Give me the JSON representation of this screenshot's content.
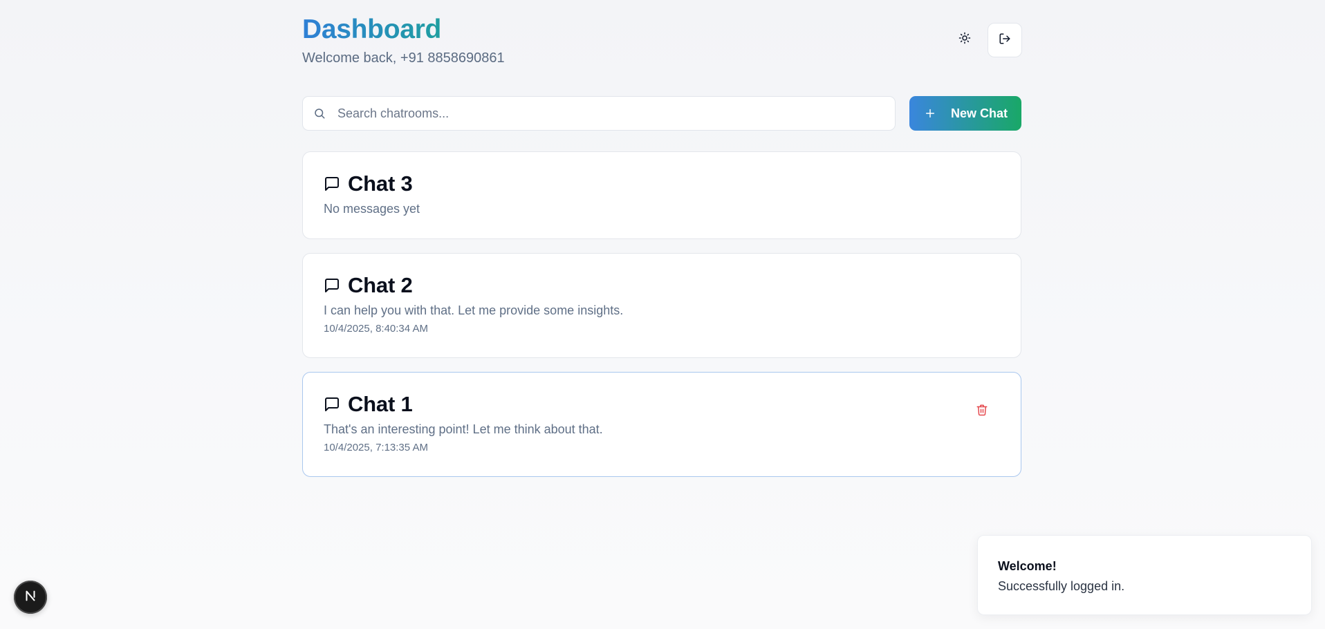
{
  "header": {
    "title": "Dashboard",
    "subtitle": "Welcome back, +91 8858690861",
    "theme_icon": "sun-icon",
    "logout_icon": "logout-icon"
  },
  "search": {
    "placeholder": "Search chatrooms...",
    "value": "",
    "icon": "search-icon"
  },
  "new_chat": {
    "label": "New Chat",
    "icon": "plus-icon"
  },
  "chats": [
    {
      "title": "Chat 3",
      "last_message": "No messages yet",
      "timestamp": ""
    },
    {
      "title": "Chat 2",
      "last_message": "I can help you with that. Let me provide some insights.",
      "timestamp": "10/4/2025, 8:40:34 AM"
    },
    {
      "title": "Chat 1",
      "last_message": "That's an interesting point! Let me think about that.",
      "timestamp": "10/4/2025, 7:13:35 AM"
    }
  ],
  "toast": {
    "title": "Welcome!",
    "message": "Successfully logged in."
  },
  "devtools": {
    "label": "N"
  },
  "colors": {
    "accent_blue": "#3a86dd",
    "accent_green": "#19a867",
    "danger": "#e5484d",
    "active_border": "#a9c7ee"
  }
}
